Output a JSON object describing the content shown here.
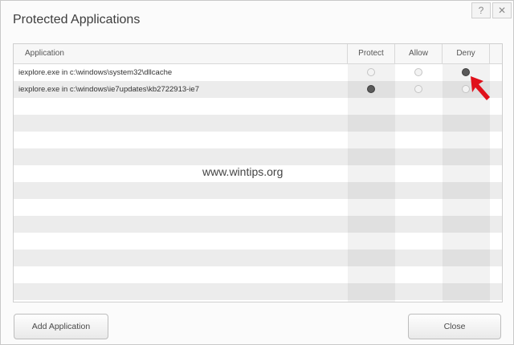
{
  "window": {
    "title": "Protected Applications"
  },
  "titlebar": {
    "help_icon": "?",
    "close_icon": "✕"
  },
  "grid": {
    "columns": [
      "Application",
      "Protect",
      "Allow",
      "Deny"
    ],
    "rows": [
      {
        "application": "iexplore.exe in c:\\windows\\system32\\dllcache",
        "selected": "Deny"
      },
      {
        "application": "iexplore.exe in c:\\windows\\ie7updates\\kb2722913-ie7",
        "selected": "Protect"
      }
    ]
  },
  "buttons": {
    "add_application": "Add Application",
    "close": "Close"
  },
  "watermark": "www.wintips.org",
  "annotation": {
    "arrow_color": "#e0101a"
  }
}
